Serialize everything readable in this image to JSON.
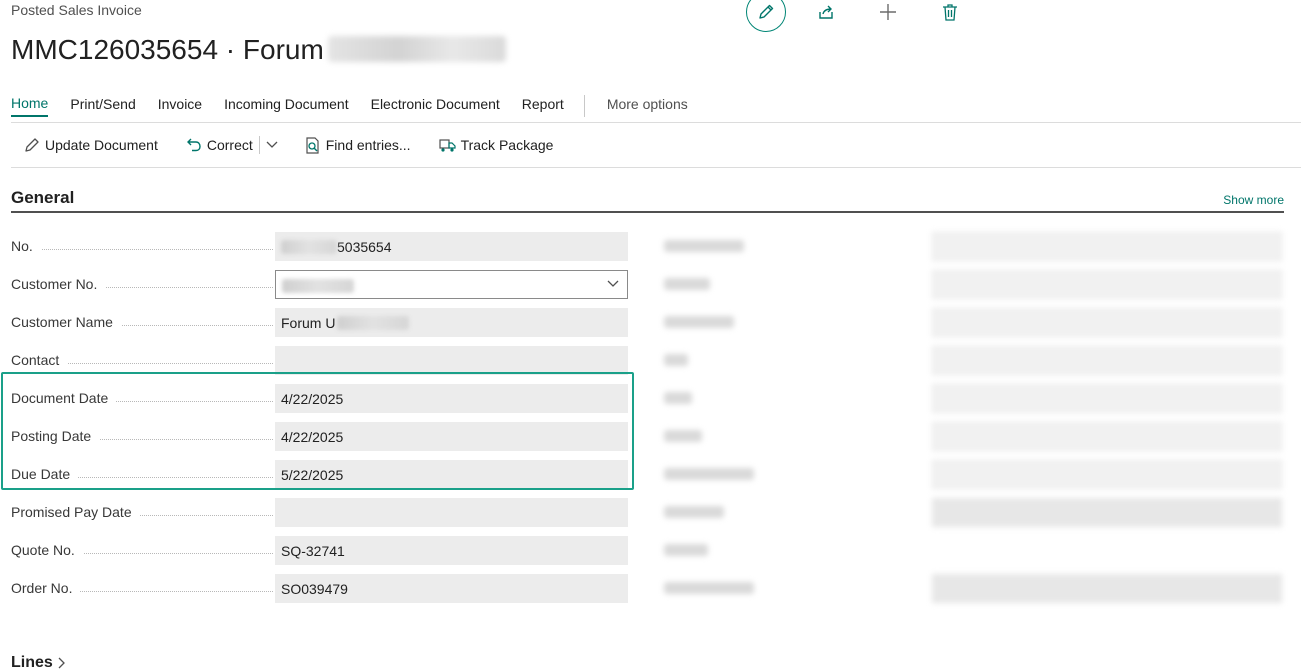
{
  "page": {
    "breadcrumb": "Posted Sales Invoice",
    "title": "MMC126035654 · Forum"
  },
  "tabs": [
    {
      "label": "Home"
    },
    {
      "label": "Print/Send"
    },
    {
      "label": "Invoice"
    },
    {
      "label": "Incoming Document"
    },
    {
      "label": "Electronic Document"
    },
    {
      "label": "Report"
    },
    {
      "label": "More options"
    }
  ],
  "actions": {
    "update_document": "Update Document",
    "correct": "Correct",
    "find_entries": "Find entries...",
    "track_package": "Track Package"
  },
  "general": {
    "title": "General",
    "show_more": "Show more",
    "fields": [
      {
        "label": "No.",
        "value": "5035654"
      },
      {
        "label": "Customer No.",
        "value": ""
      },
      {
        "label": "Customer Name",
        "value": "Forum U"
      },
      {
        "label": "Contact",
        "value": ""
      },
      {
        "label": "Document Date",
        "value": "4/22/2025"
      },
      {
        "label": "Posting Date",
        "value": "4/22/2025"
      },
      {
        "label": "Due Date",
        "value": "5/22/2025"
      },
      {
        "label": "Promised Pay Date",
        "value": ""
      },
      {
        "label": "Quote No.",
        "value": "SQ-32741"
      },
      {
        "label": "Order No.",
        "value": "SO039479"
      }
    ]
  },
  "lines": {
    "title": "Lines"
  },
  "colors": {
    "accent": "#00756a",
    "highlight": "#1aa089"
  },
  "icons": {
    "edit": "pencil-icon",
    "share": "share-icon",
    "new": "plus-icon",
    "delete": "trash-icon"
  }
}
